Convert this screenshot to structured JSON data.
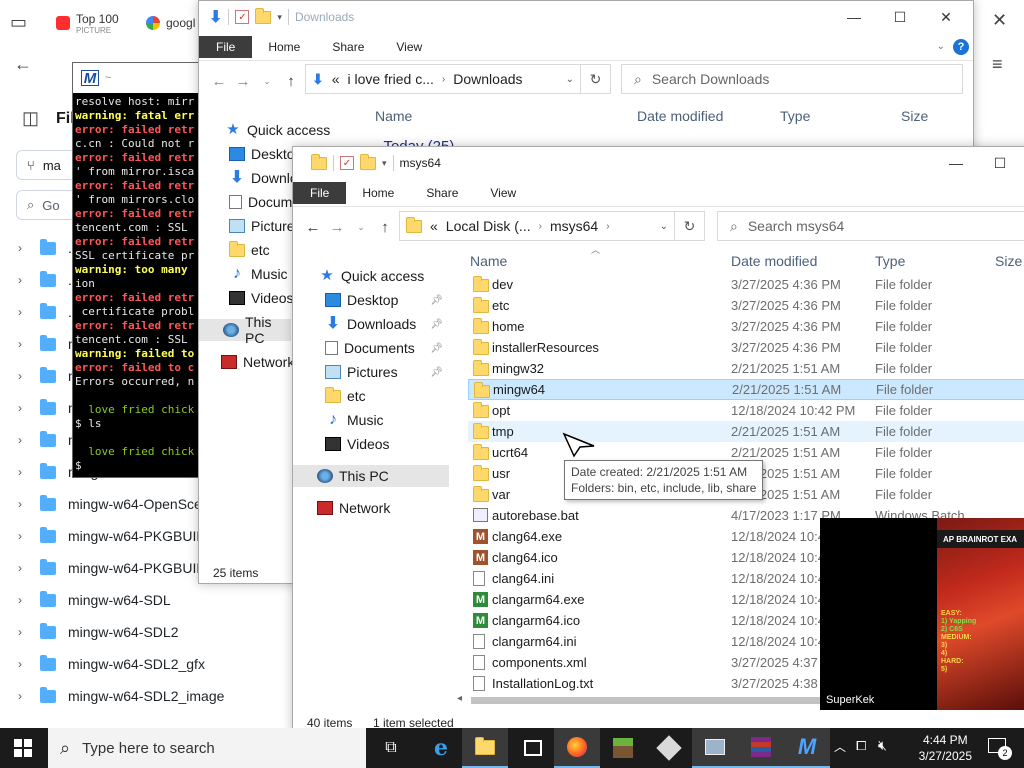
{
  "browser": {
    "tabs": [
      {
        "title": "Top 100",
        "subtitle": "PICTURE"
      },
      {
        "title": "googl"
      }
    ],
    "repo_partial": {
      "heading": "Fil",
      "branch": "ma",
      "search": "Go"
    },
    "folders": [
      ".c",
      ".ci",
      ".g",
      "m",
      "m",
      "m",
      "m",
      "mingw-w64-MinHook",
      "mingw-w64-OpenSce",
      "mingw-w64-PKGBUIL",
      "mingw-w64-PKGBUILD-templates",
      "mingw-w64-SDL",
      "mingw-w64-SDL2",
      "mingw-w64-SDL2_gfx",
      "mingw-w64-SDL2_image"
    ]
  },
  "terminal": {
    "lines": [
      {
        "cls": "",
        "text": "resolve host: mirr"
      },
      {
        "cls": "t-warn",
        "text": "warning: fatal err"
      },
      {
        "cls": "t-err",
        "text": "error: failed retr"
      },
      {
        "cls": "",
        "text": "c.cn : Could not r"
      },
      {
        "cls": "t-err",
        "text": "error: failed retr"
      },
      {
        "cls": "",
        "text": "' from mirror.isca"
      },
      {
        "cls": "t-err",
        "text": "error: failed retr"
      },
      {
        "cls": "",
        "text": "' from mirrors.clo"
      },
      {
        "cls": "t-err",
        "text": "error: failed retr"
      },
      {
        "cls": "",
        "text": "tencent.com : SSL"
      },
      {
        "cls": "t-err",
        "text": "error: failed retr"
      },
      {
        "cls": "",
        "text": "SSL certificate pr"
      },
      {
        "cls": "t-warn",
        "text": "warning: too many"
      },
      {
        "cls": "",
        "text": "ion"
      },
      {
        "cls": "t-err",
        "text": "error: failed retr"
      },
      {
        "cls": "",
        "text": " certificate probl"
      },
      {
        "cls": "t-err",
        "text": "error: failed retr"
      },
      {
        "cls": "",
        "text": "tencent.com : SSL"
      },
      {
        "cls": "t-warn",
        "text": "warning: failed to"
      },
      {
        "cls": "t-err",
        "text": "error: failed to c"
      },
      {
        "cls": "",
        "text": "Errors occurred, n"
      },
      {
        "cls": "",
        "text": " "
      },
      {
        "cls": "t-green",
        "text": "  love fried chick"
      },
      {
        "cls": "",
        "text": "$ ls"
      },
      {
        "cls": "",
        "text": " "
      },
      {
        "cls": "t-green",
        "text": "  love fried chick"
      },
      {
        "cls": "",
        "text": "$ "
      }
    ]
  },
  "downloads_window": {
    "title": "Downloads",
    "ribbon": [
      "File",
      "Home",
      "Share",
      "View"
    ],
    "address": {
      "crumb_prefix": "«",
      "crumbs": [
        "i love fried c...",
        "Downloads"
      ]
    },
    "search_placeholder": "Search Downloads",
    "columns": [
      "Name",
      "Date modified",
      "Type",
      "Size"
    ],
    "group_header": "Today (25)",
    "nav": [
      {
        "label": "Quick access",
        "icon": "star"
      },
      {
        "label": "Deskto",
        "icon": "desk"
      },
      {
        "label": "Downlo",
        "icon": "down"
      },
      {
        "label": "Docum",
        "icon": "doc"
      },
      {
        "label": "Picture",
        "icon": "pic"
      },
      {
        "label": "etc",
        "icon": "folder"
      },
      {
        "label": "Music",
        "icon": "music"
      },
      {
        "label": "Videos",
        "icon": "video"
      },
      {
        "label": "This PC",
        "icon": "pc"
      },
      {
        "label": "Network",
        "icon": "net"
      }
    ],
    "status": "25 items"
  },
  "msys_window": {
    "title": "msys64",
    "ribbon": [
      "File",
      "Home",
      "Share",
      "View"
    ],
    "address": {
      "crumb_prefix": "«",
      "crumbs": [
        "Local Disk (...",
        "msys64"
      ]
    },
    "search_placeholder": "Search msys64",
    "columns": [
      "Name",
      "Date modified",
      "Type",
      "Size"
    ],
    "nav": [
      {
        "label": "Quick access",
        "icon": "star",
        "pinned": false
      },
      {
        "label": "Desktop",
        "icon": "desk",
        "pinned": true
      },
      {
        "label": "Downloads",
        "icon": "down",
        "pinned": true
      },
      {
        "label": "Documents",
        "icon": "doc",
        "pinned": true
      },
      {
        "label": "Pictures",
        "icon": "pic",
        "pinned": true
      },
      {
        "label": "etc",
        "icon": "folder",
        "pinned": false
      },
      {
        "label": "Music",
        "icon": "music",
        "pinned": false
      },
      {
        "label": "Videos",
        "icon": "video",
        "pinned": false
      },
      {
        "label": "This PC",
        "icon": "pc",
        "pinned": false
      },
      {
        "label": "Network",
        "icon": "net",
        "pinned": false
      }
    ],
    "files": [
      {
        "name": "dev",
        "date": "3/27/2025 4:36 PM",
        "type": "File folder",
        "icon": "folder"
      },
      {
        "name": "etc",
        "date": "3/27/2025 4:36 PM",
        "type": "File folder",
        "icon": "folder"
      },
      {
        "name": "home",
        "date": "3/27/2025 4:36 PM",
        "type": "File folder",
        "icon": "folder"
      },
      {
        "name": "installerResources",
        "date": "3/27/2025 4:36 PM",
        "type": "File folder",
        "icon": "folder"
      },
      {
        "name": "mingw32",
        "date": "2/21/2025 1:51 AM",
        "type": "File folder",
        "icon": "folder"
      },
      {
        "name": "mingw64",
        "date": "2/21/2025 1:51 AM",
        "type": "File folder",
        "icon": "folder",
        "state": "sel"
      },
      {
        "name": "opt",
        "date": "12/18/2024 10:42 PM",
        "type": "File folder",
        "icon": "folder"
      },
      {
        "name": "tmp",
        "date": "2/21/2025 1:51 AM",
        "type": "File folder",
        "icon": "folder",
        "state": "hov"
      },
      {
        "name": "ucrt64",
        "date": "2/21/2025 1:51 AM",
        "type": "File folder",
        "icon": "folder"
      },
      {
        "name": "usr",
        "date": "2/21/2025 1:51 AM",
        "type": "File folder",
        "icon": "folder"
      },
      {
        "name": "var",
        "date": "2/21/2025 1:51 AM",
        "type": "File folder",
        "icon": "folder"
      },
      {
        "name": "autorebase.bat",
        "date": "4/17/2023 1:17 PM",
        "type": "Windows Batch",
        "icon": "bat"
      },
      {
        "name": "clang64.exe",
        "date": "12/18/2024 10:4",
        "type": "",
        "icon": "exe-brown"
      },
      {
        "name": "clang64.ico",
        "date": "12/18/2024 10:4",
        "type": "",
        "icon": "exe-brown"
      },
      {
        "name": "clang64.ini",
        "date": "12/18/2024 10:4",
        "type": "",
        "icon": "txt"
      },
      {
        "name": "clangarm64.exe",
        "date": "12/18/2024 10:4",
        "type": "",
        "icon": "exe-green"
      },
      {
        "name": "clangarm64.ico",
        "date": "12/18/2024 10:4",
        "type": "",
        "icon": "exe-green"
      },
      {
        "name": "clangarm64.ini",
        "date": "12/18/2024 10:4",
        "type": "",
        "icon": "txt"
      },
      {
        "name": "components.xml",
        "date": "3/27/2025 4:37",
        "type": "",
        "icon": "txt"
      },
      {
        "name": "InstallationLog.txt",
        "date": "3/27/2025 4:38",
        "type": "",
        "icon": "txt"
      }
    ],
    "tooltip": {
      "line1": "Date created: 2/21/2025 1:51 AM",
      "line2": "Folders: bin, etc, include, lib, share"
    },
    "status_items": "40 items",
    "status_selected": "1 item selected"
  },
  "video_overlay": {
    "banner": "AP BRAINROT EXA",
    "text_lines": [
      "EASY:",
      "1) Yapping",
      "2) C6S",
      "MEDIUM:",
      "3)",
      "4)",
      "HARD:",
      "5)"
    ],
    "label": "SuperKek"
  },
  "taskbar": {
    "search_placeholder": "Type here to search",
    "time": "4:44 PM",
    "date": "3/27/2025",
    "notifications": "2"
  },
  "colors": {
    "accent": "#0078d7",
    "selection": "#cce8ff",
    "hover": "#e5f3ff",
    "taskbar": "#1b1b1b"
  }
}
